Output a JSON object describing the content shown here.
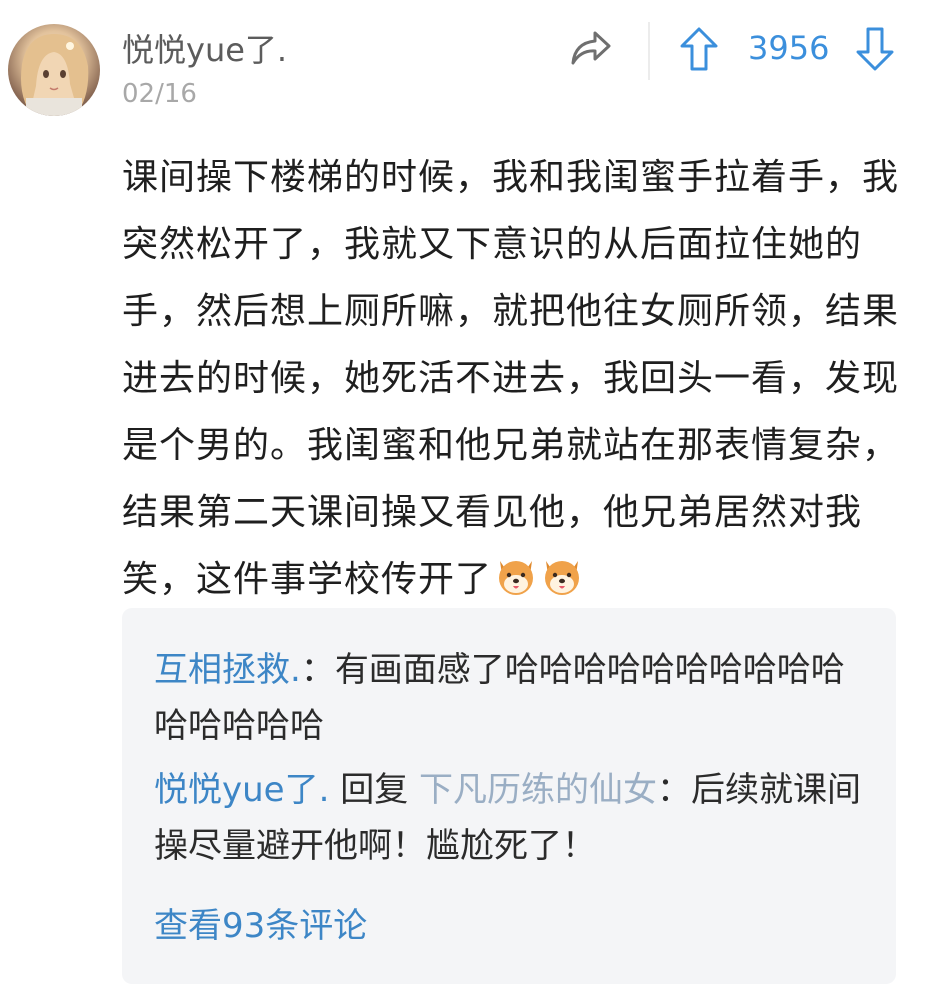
{
  "post": {
    "author": "悦悦yue了.",
    "date": "02/16",
    "votes": "3956",
    "body_text": "课间操下楼梯的时候，我和我闺蜜手拉着手，我突然松开了，我就又下意识的从后面拉住她的手，然后想上厕所嘛，就把他往女厕所领，结果进去的时候，她死活不进去，我回头一看，发现是个男的。我闺蜜和他兄弟就站在那表情复杂，结果第二天课间操又看见他，他兄弟居然对我笑，这件事学校传开了",
    "emojis": [
      "dog-face-emoji",
      "dog-face-emoji"
    ]
  },
  "actions": {
    "share_icon": "share-arrow-icon",
    "upvote_icon": "upvote-arrow-icon",
    "downvote_icon": "downvote-arrow-icon"
  },
  "comments": [
    {
      "user": "互相拯救.",
      "separator": "：",
      "text": "有画面感了哈哈哈哈哈哈哈哈哈哈哈哈哈哈哈"
    },
    {
      "user": "悦悦yue了.",
      "reply_word": " 回复 ",
      "reply_to": "下凡历练的仙女",
      "separator": "：",
      "text": "后续就课间操尽量避开他啊！尴尬死了！"
    }
  ],
  "view_more": "查看93条评论",
  "colors": {
    "link_blue": "#3d86c6",
    "vote_blue": "#3b8fdc",
    "muted_gray": "#a8a8a8",
    "comment_bg": "#f4f5f7"
  }
}
